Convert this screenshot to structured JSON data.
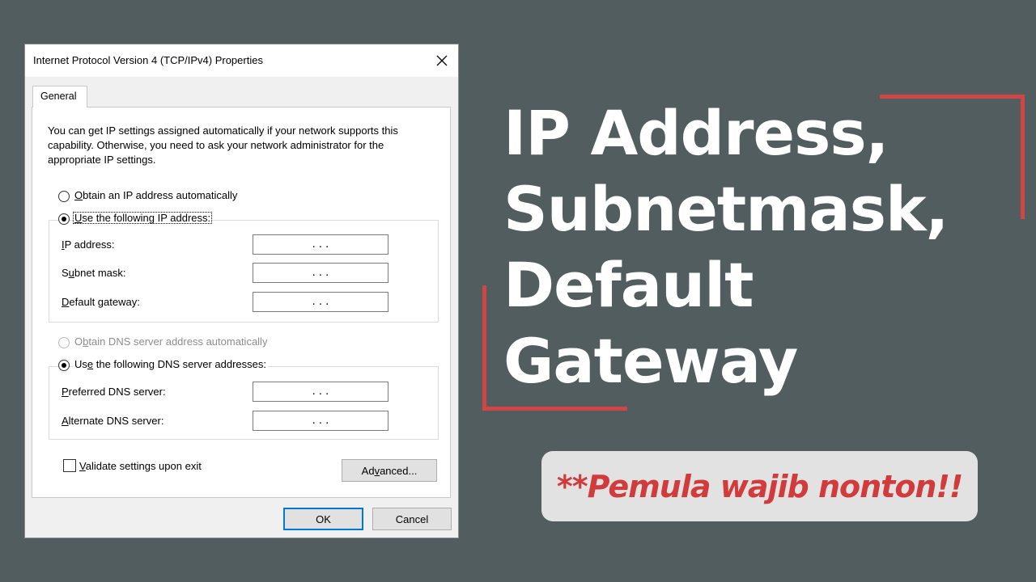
{
  "window": {
    "title": "Internet Protocol Version 4 (TCP/IPv4) Properties",
    "close_icon": "close-icon"
  },
  "tabs": [
    {
      "label": "General",
      "selected": true
    }
  ],
  "description": "You can get IP settings assigned automatically if your network supports this capability. Otherwise, you need to ask your network administrator for the appropriate IP settings.",
  "ip_section": {
    "auto_radio": {
      "prefix": "",
      "mnemonic": "O",
      "rest": "btain an IP address automatically",
      "checked": false
    },
    "manual_radio": {
      "prefix": "",
      "mnemonic": "U",
      "rest": "se the following IP address:",
      "checked": true
    },
    "fields": [
      {
        "prefix": "",
        "mnemonic": "I",
        "rest": "P address:",
        "value": ". . ."
      },
      {
        "prefix": "S",
        "mnemonic": "u",
        "rest": "bnet mask:",
        "value": ". . ."
      },
      {
        "prefix": "",
        "mnemonic": "D",
        "rest": "efault gateway:",
        "value": ". . ."
      }
    ]
  },
  "dns_section": {
    "auto_radio": {
      "prefix": "O",
      "mnemonic": "b",
      "rest": "tain DNS server address automatically",
      "checked": false,
      "disabled": true
    },
    "manual_radio": {
      "prefix": "Us",
      "mnemonic": "e",
      "rest": " the following DNS server addresses:",
      "checked": true
    },
    "fields": [
      {
        "prefix": "",
        "mnemonic": "P",
        "rest": "referred DNS server:",
        "value": ". . ."
      },
      {
        "prefix": "",
        "mnemonic": "A",
        "rest": "lternate DNS server:",
        "value": ". . ."
      }
    ]
  },
  "validate_checkbox": {
    "prefix": "",
    "mnemonic": "V",
    "rest": "alidate settings upon exit",
    "checked": false
  },
  "buttons": {
    "advanced": {
      "prefix": "Ad",
      "mnemonic": "v",
      "rest": "anced..."
    },
    "ok": "OK",
    "cancel": "Cancel"
  },
  "graphic": {
    "headline": [
      "IP Address,",
      "Subnetmask,",
      "Default",
      "Gateway"
    ],
    "pill_text": "**Pemula wajib nonton!!",
    "accent_color": "#d24545",
    "background_color": "#525d5f"
  }
}
